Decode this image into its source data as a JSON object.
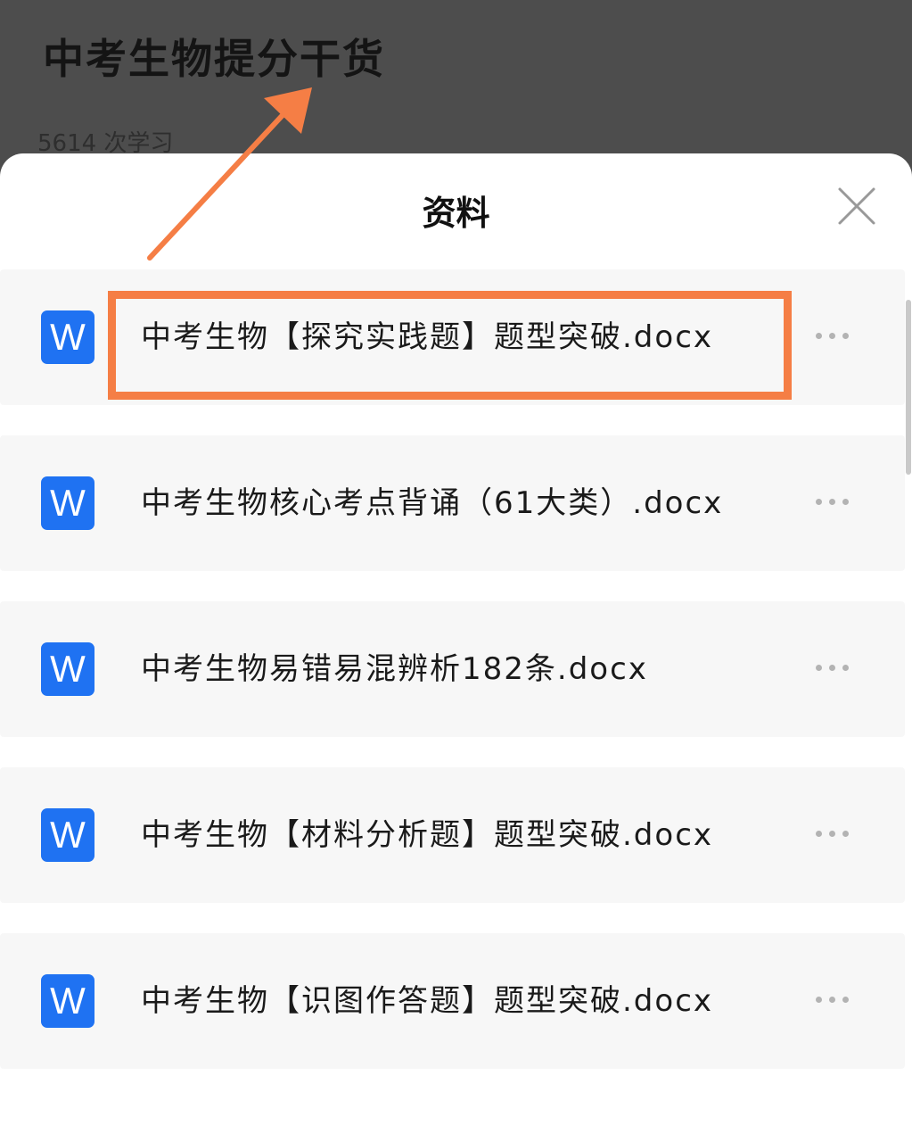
{
  "background_page": {
    "title": "中考生物提分干货",
    "study_count": "5614 次学习"
  },
  "sheet": {
    "title": "资料",
    "close_icon": "close-icon"
  },
  "files": [
    {
      "name": "中考生物【探究实践题】题型突破.docx",
      "icon": "word-file-icon",
      "icon_letter": "W"
    },
    {
      "name": "中考生物核心考点背诵（61大类）.docx",
      "icon": "word-file-icon",
      "icon_letter": "W"
    },
    {
      "name": "中考生物易错易混辨析182条.docx",
      "icon": "word-file-icon",
      "icon_letter": "W"
    },
    {
      "name": "中考生物【材料分析题】题型突破.docx",
      "icon": "word-file-icon",
      "icon_letter": "W"
    },
    {
      "name": "中考生物【识图作答题】题型突破.docx",
      "icon": "word-file-icon",
      "icon_letter": "W"
    }
  ],
  "colors": {
    "word_icon": "#1f72f2",
    "annotation": "#f57e45",
    "overlay": "#4d4d4d"
  }
}
